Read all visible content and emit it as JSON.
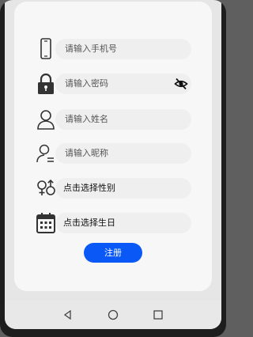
{
  "form": {
    "phone": {
      "icon": "phone-icon",
      "placeholder": "请输入手机号"
    },
    "password": {
      "icon": "lock-icon",
      "placeholder": "请输入密码",
      "toggle_icon": "eye-off-icon"
    },
    "name": {
      "icon": "person-icon",
      "placeholder": "请输入姓名"
    },
    "nickname": {
      "icon": "person-nickname-icon",
      "placeholder": "请输入昵称"
    },
    "gender": {
      "icon": "gender-icon",
      "label": "点击选择性别"
    },
    "birthday": {
      "icon": "calendar-icon",
      "label": "点击选择生日"
    },
    "register_label": "注册"
  },
  "navbar": {
    "back": "back-triangle-icon",
    "home": "home-circle-icon",
    "recents": "recents-square-icon"
  },
  "colors": {
    "accent": "#0a59f7",
    "card": "#f7f7f7",
    "field": "#efefef"
  }
}
